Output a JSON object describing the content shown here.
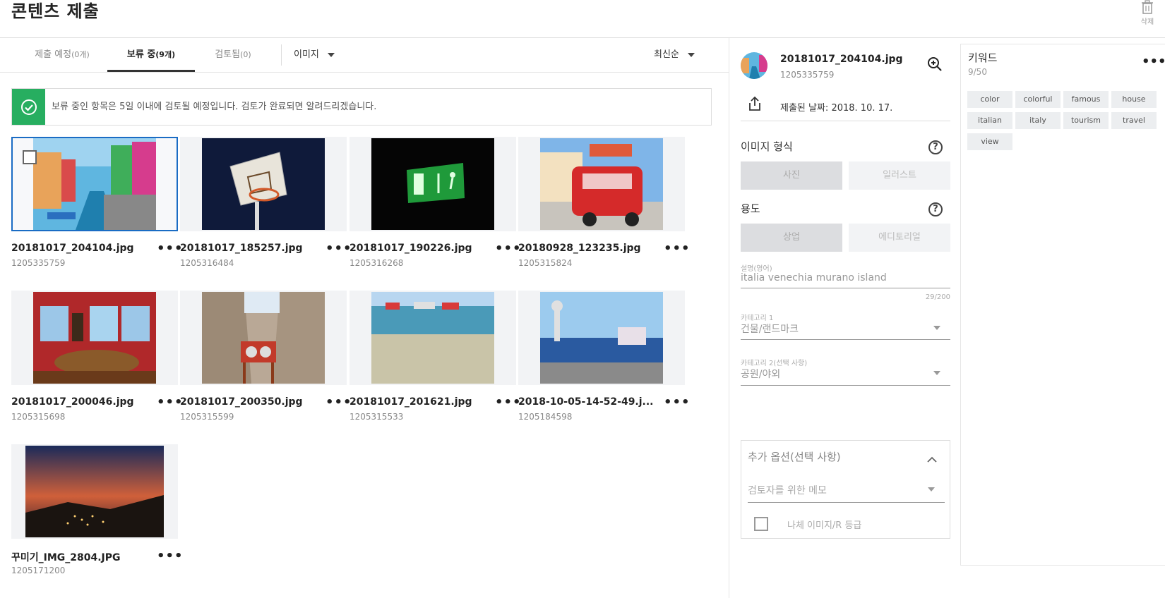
{
  "header": {
    "title": "콘텐츠 제출",
    "delete_label": "삭제"
  },
  "tabs": [
    {
      "label": "제출 예정",
      "count": "(0개)"
    },
    {
      "label": "보류 중",
      "count": "(9개)"
    },
    {
      "label": "검토됨",
      "count": "(0)"
    }
  ],
  "type_filter": "이미지",
  "sort": "최신순",
  "notice": "보류 중인 항목은 5일 이내에 검토될 예정입니다. 검토가 완료되면 알려드리겠습니다.",
  "items": [
    {
      "name": "20181017_204104.jpg",
      "id": "1205335759"
    },
    {
      "name": "20181017_185257.jpg",
      "id": "1205316484"
    },
    {
      "name": "20181017_190226.jpg",
      "id": "1205316268"
    },
    {
      "name": "20180928_123235.jpg",
      "id": "1205315824"
    },
    {
      "name": "20181017_200046.jpg",
      "id": "1205315698"
    },
    {
      "name": "20181017_200350.jpg",
      "id": "1205315599"
    },
    {
      "name": "20181017_201621.jpg",
      "id": "1205315533"
    },
    {
      "name": "2018-10-05-14-52-49.j...",
      "id": "1205184598"
    },
    {
      "name": "꾸미기_IMG_2804.JPG",
      "id": "1205171200"
    }
  ],
  "detail": {
    "filename": "20181017_204104.jpg",
    "id": "1205335759",
    "submitted_date": "제출된 날짜: 2018. 10. 17.",
    "image_type_label": "이미지 형식",
    "image_type_options": [
      "사진",
      "일러스트"
    ],
    "usage_label": "용도",
    "usage_options": [
      "상업",
      "에디토리얼"
    ],
    "description_label": "설명(영어)",
    "description_value": "italia venechia murano island",
    "description_counter": "29/200",
    "category1_label": "카테고리 1",
    "category1_value": "건물/랜드마크",
    "category2_label": "카테고리 2(선택 사항)",
    "category2_value": "공원/야외",
    "extra_options_title": "추가 옵션(선택 사항)",
    "reviewer_memo": "검토자를 위한 메모",
    "alt_image_label": "나체 이미지/R 등급"
  },
  "keywords": {
    "title": "키워드",
    "count": "9/50",
    "items": [
      "color",
      "colorful",
      "famous",
      "house",
      "italian",
      "italy",
      "tourism",
      "travel",
      "view"
    ]
  }
}
